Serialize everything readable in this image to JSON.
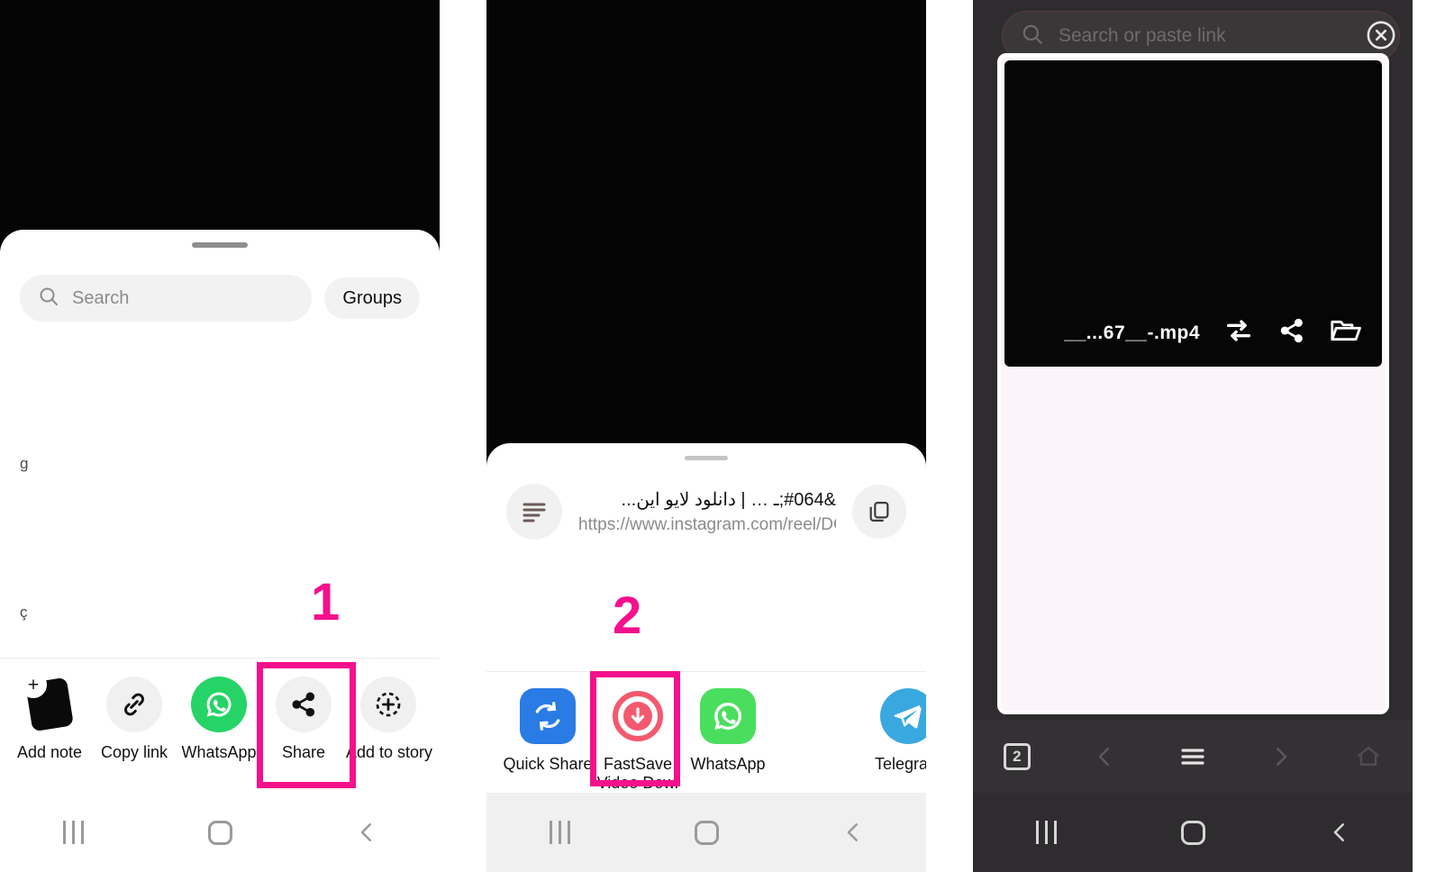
{
  "tutorial": {
    "accent_pink": "#F5108C",
    "steps": [
      {
        "number": "1",
        "panel": 1,
        "target": "Share"
      },
      {
        "number": "2",
        "panel": 2,
        "target": "FastSave Video Dow."
      }
    ]
  },
  "panel1": {
    "name": "instagram-share-sheet",
    "search": {
      "placeholder": "Search",
      "icon": "search-icon"
    },
    "groups_button": "Groups",
    "edge_fragments": [
      "g",
      "ç"
    ],
    "share_targets": [
      {
        "label": "Add note",
        "icon": "add-note-icon",
        "style": "note"
      },
      {
        "label": "Copy link",
        "icon": "link-icon",
        "style": "grey"
      },
      {
        "label": "WhatsApp",
        "icon": "whatsapp-icon",
        "style": "green"
      },
      {
        "label": "Share",
        "icon": "share-nodes-icon",
        "style": "grey"
      },
      {
        "label": "Add to story",
        "icon": "add-to-story-icon",
        "style": "grey"
      }
    ],
    "navbar": {
      "recents": "recents-icon",
      "home": "home-icon",
      "back": "back-icon"
    }
  },
  "panel2": {
    "name": "android-system-share-sheet",
    "header": {
      "leading_icon": "text-lines-icon",
      "title": "&#064;ـ      …  |  دانلود لایو این...",
      "url": "https://www.instagram.com/reel/DGm...",
      "copy_icon": "copy-icon"
    },
    "apps": [
      {
        "label": "Quick Share",
        "icon": "quick-share-icon",
        "color": "#2a7be4"
      },
      {
        "label": "FastSave\nVideo Dow.",
        "icon": "fastsave-icon",
        "color": "#f0465e"
      },
      {
        "label": "WhatsApp",
        "icon": "whatsapp-icon",
        "color": "#4ade5e"
      },
      {
        "label": "",
        "icon": "empty-slot",
        "color": "#ffffff"
      },
      {
        "label": "Telegram",
        "icon": "telegram-icon",
        "color": "#3aa8e0"
      }
    ],
    "navbar": {
      "recents": "recents-icon",
      "home": "home-icon",
      "back": "back-icon"
    }
  },
  "panel3": {
    "name": "fastsave-downloader-app",
    "search": {
      "placeholder": "Search or paste link",
      "icon": "search-icon",
      "clear_icon": "close-circle-icon"
    },
    "video": {
      "filename": "__...67__-.mp4",
      "actions": [
        {
          "icon": "repeat-icon",
          "name": "repeat-button"
        },
        {
          "icon": "share-icon",
          "name": "share-button"
        },
        {
          "icon": "folder-icon",
          "name": "open-folder-button"
        }
      ]
    },
    "browser_toolbar": {
      "tab_count": "2",
      "back": "chevron-left-icon",
      "menu": "menu-icon",
      "forward": "chevron-right-icon",
      "home": "home-icon"
    },
    "navbar": {
      "recents": "recents-icon",
      "home": "home-icon",
      "back": "back-icon"
    }
  }
}
